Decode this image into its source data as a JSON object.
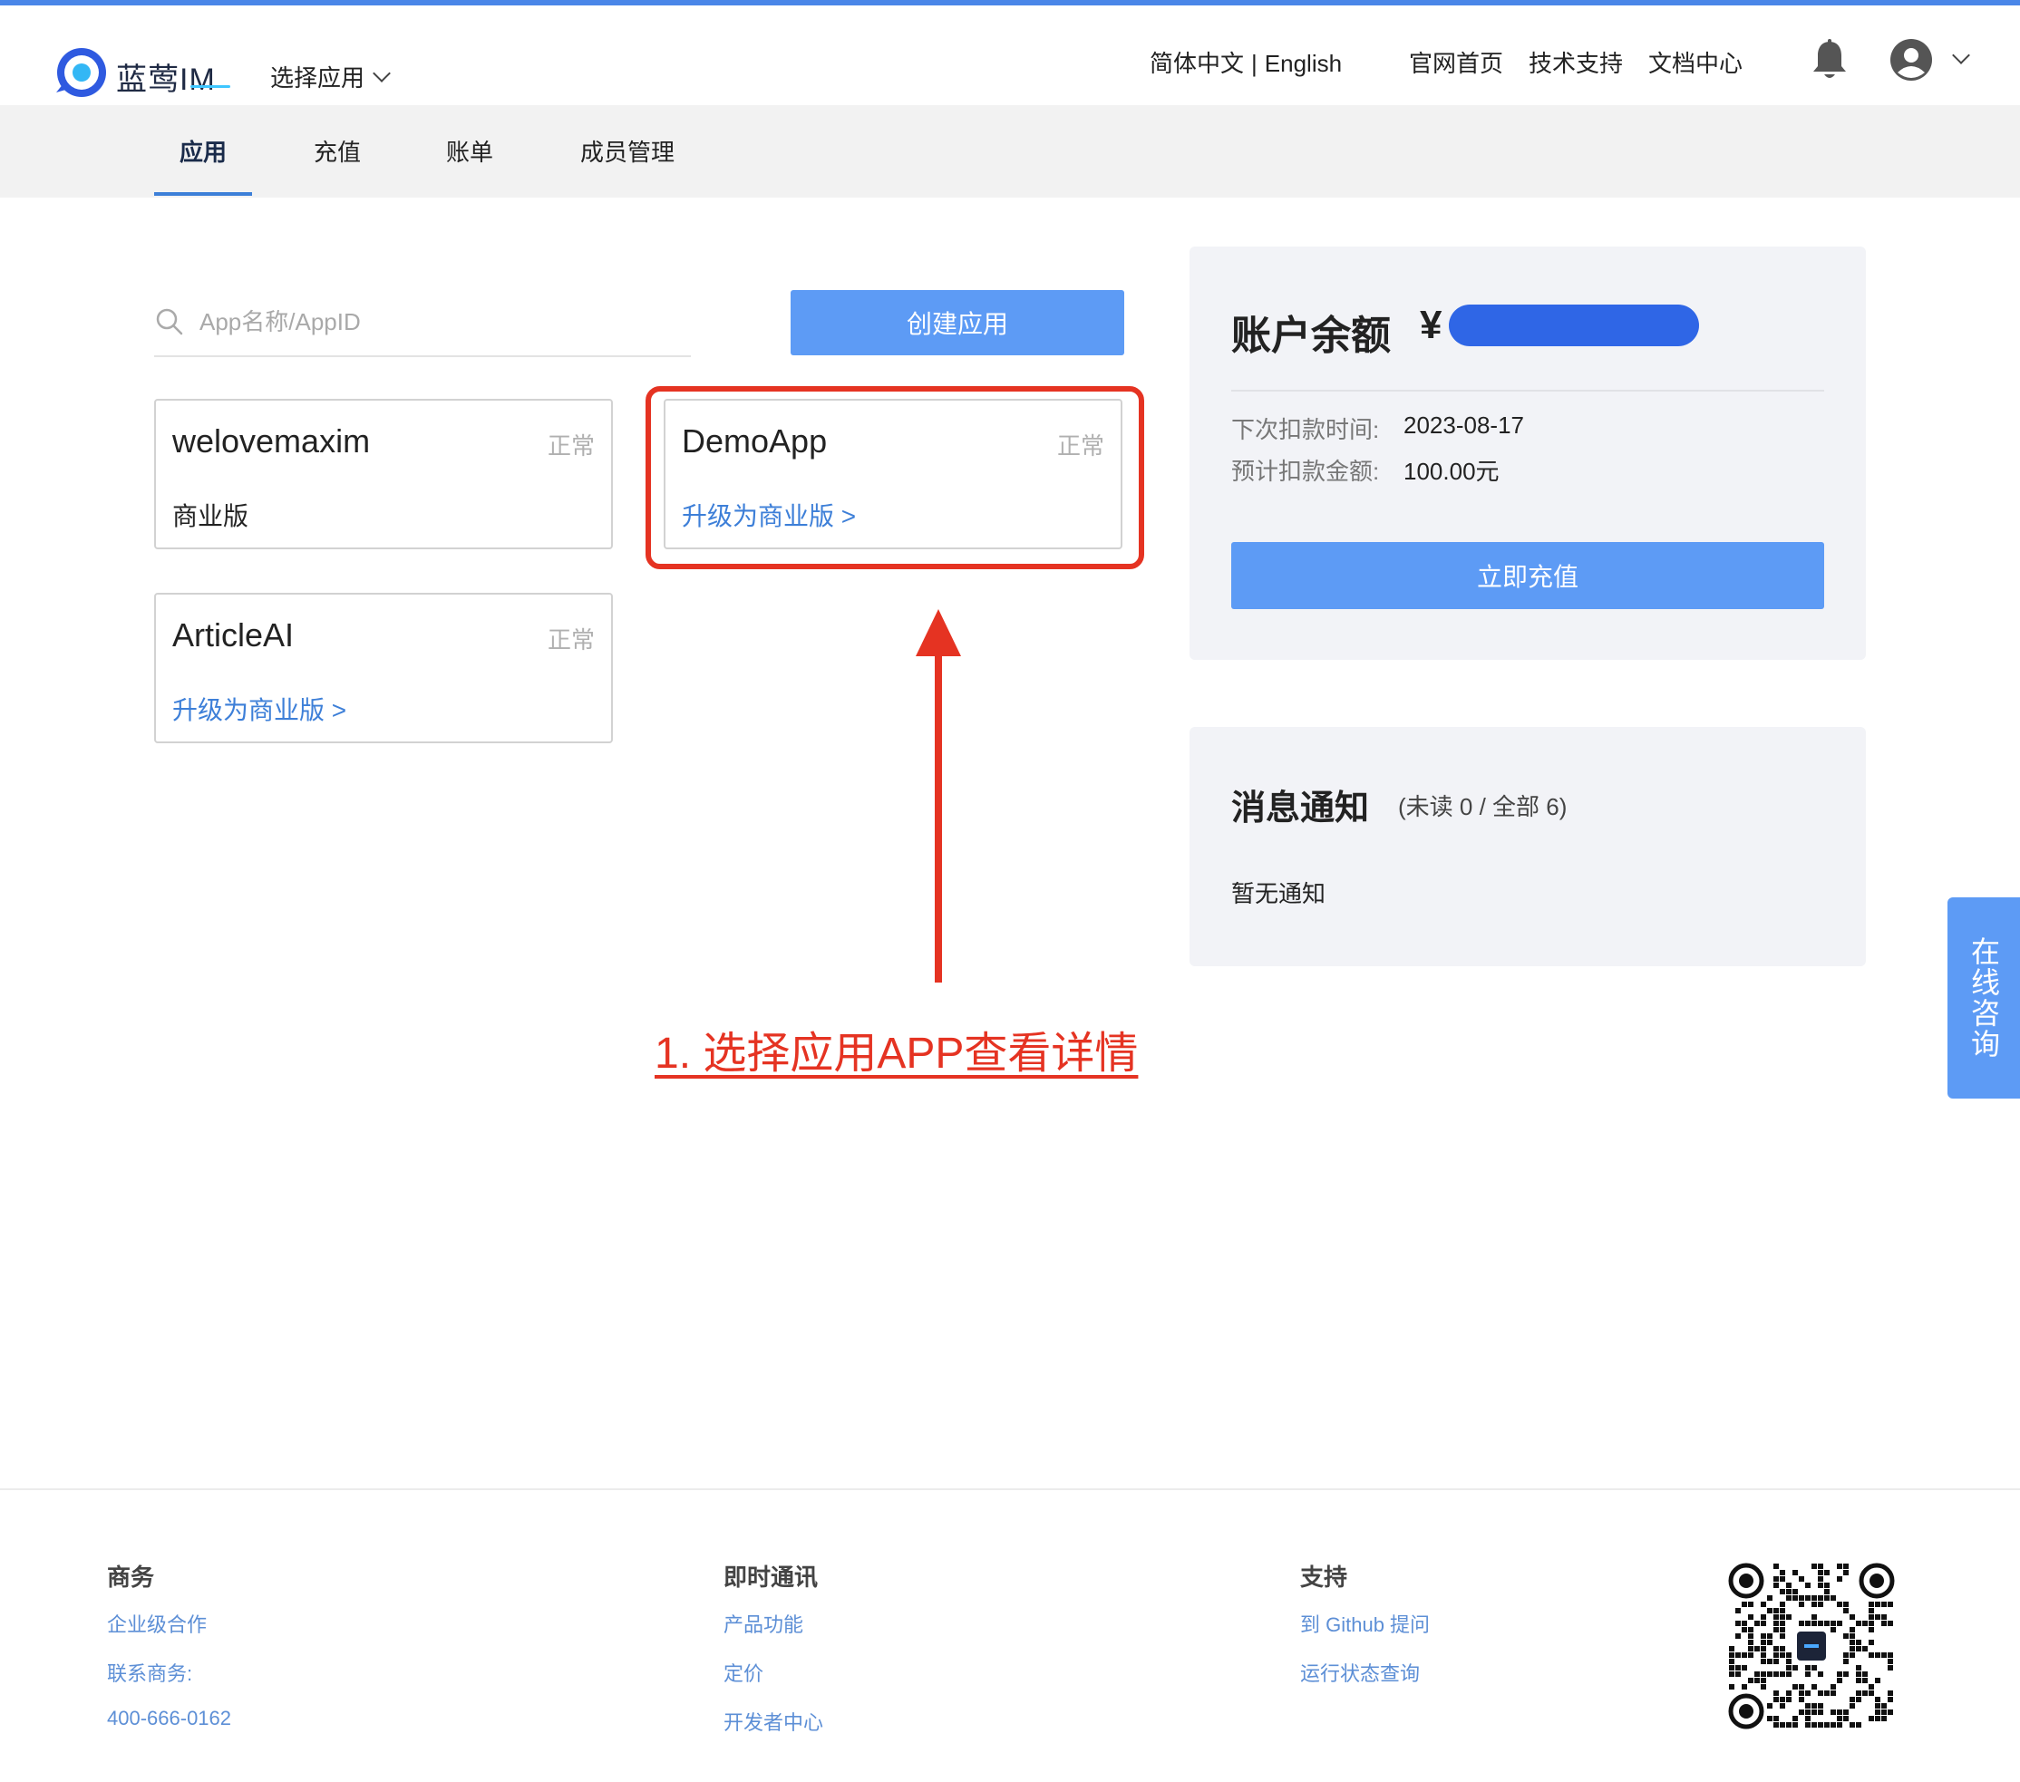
{
  "header": {
    "brand": "蓝莺IM",
    "app_select": "选择应用",
    "lang_zh": "简体中文",
    "lang_sep": "|",
    "lang_en": "English",
    "links": [
      "官网首页",
      "技术支持",
      "文档中心"
    ]
  },
  "nav": {
    "tabs": [
      "应用",
      "充值",
      "账单",
      "成员管理"
    ],
    "active": 0
  },
  "search": {
    "placeholder": "App名称/AppID",
    "value": ""
  },
  "create_button": "创建应用",
  "apps": [
    {
      "name": "welovemaxim",
      "status": "正常",
      "plan": "商业版",
      "upgrade": ""
    },
    {
      "name": "DemoApp",
      "status": "正常",
      "plan": "",
      "upgrade": "升级为商业版 >"
    },
    {
      "name": "ArticleAI",
      "status": "正常",
      "plan": "",
      "upgrade": "升级为商业版 >"
    }
  ],
  "annotation": "1. 选择应用APP查看详情",
  "balance": {
    "title": "账户余额",
    "currency": "¥",
    "next_deduct_label": "下次扣款时间:",
    "next_deduct_value": "2023-08-17",
    "est_amount_label": "预计扣款金额:",
    "est_amount_value": "100.00元",
    "recharge_button": "立即充值"
  },
  "messages": {
    "title": "消息通知",
    "count": "(未读 0 / 全部 6)",
    "empty": "暂无通知"
  },
  "consult": "在线咨询",
  "footer": {
    "business": {
      "title": "商务",
      "items": [
        "企业级合作",
        "联系商务:",
        "400-666-0162"
      ]
    },
    "im": {
      "title": "即时通讯",
      "items": [
        "产品功能",
        "定价",
        "开发者中心"
      ]
    },
    "support": {
      "title": "支持",
      "items": [
        "到 Github 提问",
        "运行状态查询"
      ]
    }
  },
  "colors": {
    "accent": "#5d9bf5",
    "link": "#3d7fd8",
    "annotation": "#e53322",
    "panel_bg": "#f2f3f7",
    "nav_bg": "#f2f2f2"
  },
  "icons": [
    "logo-icon",
    "chevron-down-icon",
    "bell-icon",
    "user-avatar-icon",
    "search-icon",
    "arrow-up-icon",
    "qr-code-icon"
  ]
}
